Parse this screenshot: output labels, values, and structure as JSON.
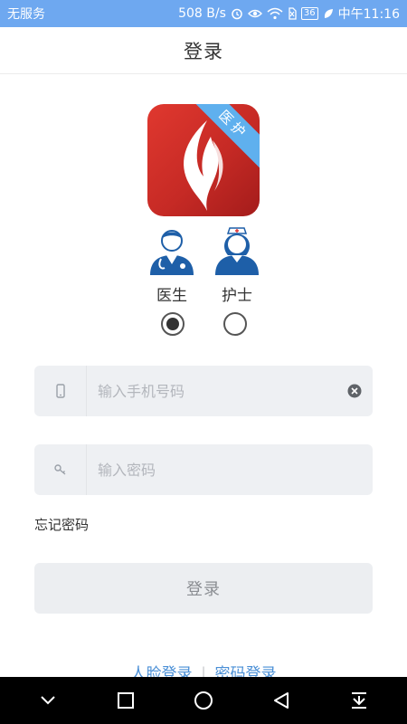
{
  "status_bar": {
    "carrier": "无服务",
    "speed": "508 B/s",
    "battery": "36",
    "time": "中午11:16"
  },
  "nav": {
    "title": "登录"
  },
  "logo": {
    "badge": "医护"
  },
  "roles": [
    {
      "label": "医生",
      "selected": true
    },
    {
      "label": "护士",
      "selected": false
    }
  ],
  "phone_field": {
    "placeholder": "输入手机号码",
    "value": ""
  },
  "password_field": {
    "placeholder": "输入密码",
    "value": ""
  },
  "forgot_password": "忘记密码",
  "login_button": "登录",
  "alt_login": {
    "face": "人脸登录",
    "separator": "|",
    "password": "密码登录"
  },
  "colors": {
    "status_bar": "#6ea8f0",
    "logo_red": "#c62a25",
    "ribbon_blue": "#5fb0ee",
    "role_blue": "#1e5fa8",
    "link_blue": "#4a8fd6"
  }
}
